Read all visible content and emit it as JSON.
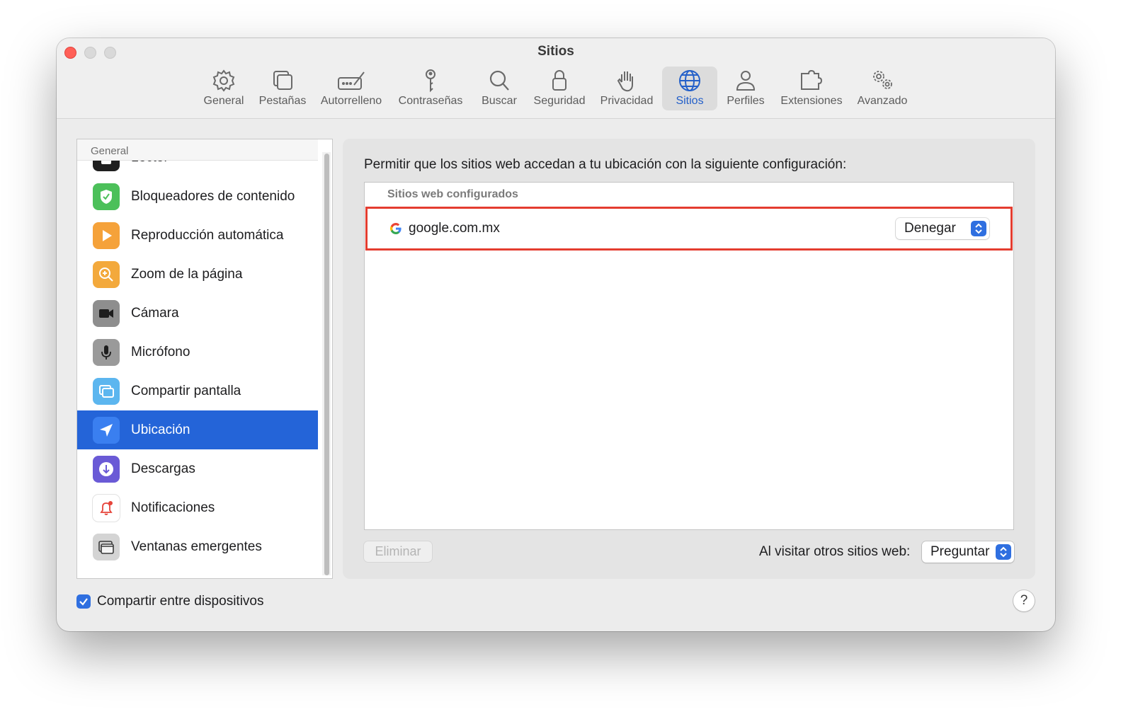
{
  "window": {
    "title": "Sitios"
  },
  "toolbar": {
    "items": [
      {
        "label": "General",
        "icon": "gear-icon"
      },
      {
        "label": "Pestañas",
        "icon": "tabs-icon"
      },
      {
        "label": "Autorrelleno",
        "icon": "autofill-pencil-icon"
      },
      {
        "label": "Contraseñas",
        "icon": "key-icon"
      },
      {
        "label": "Buscar",
        "icon": "magnifier-icon"
      },
      {
        "label": "Seguridad",
        "icon": "lock-icon"
      },
      {
        "label": "Privacidad",
        "icon": "hand-icon"
      },
      {
        "label": "Sitios",
        "icon": "globe-icon",
        "selected": true
      },
      {
        "label": "Perfiles",
        "icon": "person-icon"
      },
      {
        "label": "Extensiones",
        "icon": "puzzle-icon"
      },
      {
        "label": "Avanzado",
        "icon": "gears-icon"
      }
    ],
    "selected_color": "#2460c9"
  },
  "sidebar": {
    "header": "General",
    "items": [
      {
        "label": "Lector",
        "icon": "reader-icon"
      },
      {
        "label": "Bloqueadores de contenido",
        "icon": "content-blocker-icon"
      },
      {
        "label": "Reproducción automática",
        "icon": "autoplay-icon"
      },
      {
        "label": "Zoom de la página",
        "icon": "page-zoom-icon"
      },
      {
        "label": "Cámara",
        "icon": "camera-icon"
      },
      {
        "label": "Micrófono",
        "icon": "microphone-icon"
      },
      {
        "label": "Compartir pantalla",
        "icon": "screen-share-icon"
      },
      {
        "label": "Ubicación",
        "icon": "location-arrow-icon",
        "selected": true
      },
      {
        "label": "Descargas",
        "icon": "downloads-icon"
      },
      {
        "label": "Notificaciones",
        "icon": "notification-bell-icon"
      },
      {
        "label": "Ventanas emergentes",
        "icon": "popup-windows-icon"
      }
    ],
    "selected_color": "#2464d8"
  },
  "main": {
    "description": "Permitir que los sitios web accedan a tu ubicación con la siguiente configuración:",
    "table": {
      "header": "Sitios web configurados",
      "rows": [
        {
          "site": "google.com.mx",
          "icon": "google-g-icon",
          "setting": "Denegar"
        }
      ],
      "highlight_color": "#e43d30"
    },
    "remove_button": "Eliminar",
    "other_sites_label": "Al visitar otros sitios web:",
    "other_sites_value": "Preguntar"
  },
  "footer": {
    "share_checkbox_label": "Compartir entre dispositivos",
    "share_checked": true,
    "help_label": "?"
  }
}
